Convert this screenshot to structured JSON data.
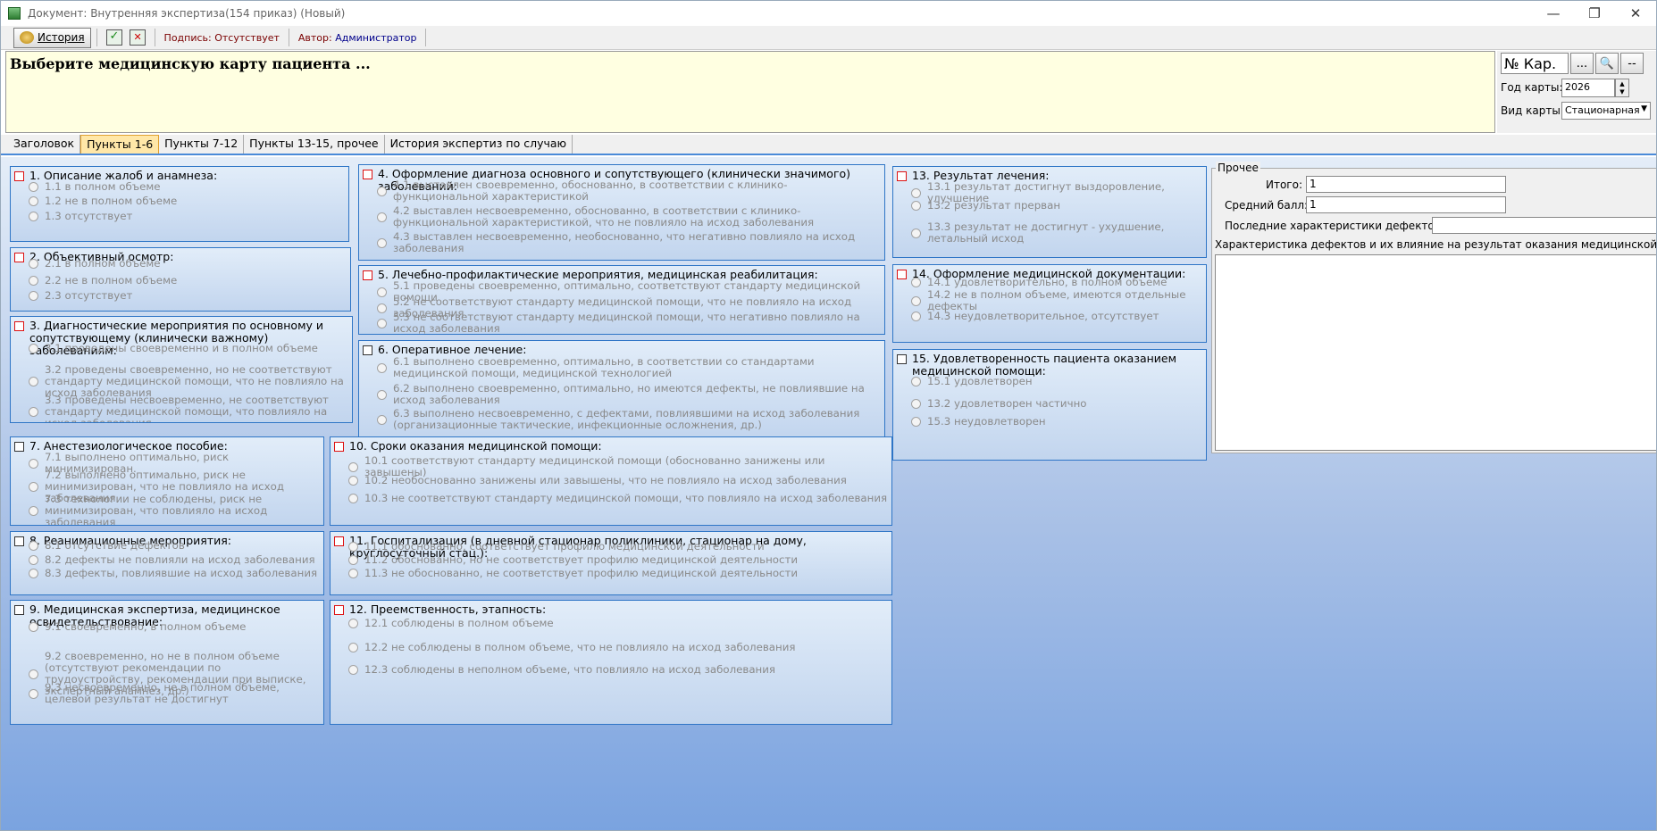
{
  "window": {
    "title": "Документ: Внутренняя экспертиза(154 приказ) (Новый)",
    "controls": [
      "—",
      "❐",
      "✕"
    ]
  },
  "toolbar": {
    "history_label": "История",
    "signature_status": "Подпись: Отсутствует",
    "author_label": "Автор:",
    "author_value": "Администратор"
  },
  "header": {
    "prompt": "Выберите медицинскую карту пациента ..."
  },
  "card_panel": {
    "card_number_placeholder": "№ Кар.",
    "browse_label": "...",
    "clear_label": "--",
    "year_label": "Год карты:",
    "year_value": "2026",
    "kind_label": "Вид карты:",
    "kind_value": "Стационарная"
  },
  "tabs": [
    "Заголовок",
    "Пункты 1-6",
    "Пункты 7-12",
    "Пункты 13-15, прочее",
    "История экспертиз по случаю"
  ],
  "active_tab": 1,
  "groups": [
    {
      "title": "1. Описание жалоб и анамнеза:",
      "checked_color": "red",
      "options": [
        "1.1 в полном объеме",
        "1.2 не в полном объеме",
        "1.3 отсутствует"
      ]
    },
    {
      "title": "2. Объективный осмотр:",
      "checked_color": "red",
      "options": [
        "2.1 в полном объеме",
        "2.2 не в полном объеме",
        "2.3 отсутствует"
      ]
    },
    {
      "title": "3. Диагностические мероприятия по основному и сопутствующему (клинически важному) заболеваниям:",
      "checked_color": "red",
      "options": [
        "3.1 проведены своевременно и в полном объеме",
        "3.2 проведены своевременно, но не соответствуют стандарту медицинской помощи, что не повлияло на исход заболевания",
        "3.3 проведены несвоевременно, не соответствуют стандарту медицинской помощи, что повлияло на исход заболевания"
      ]
    },
    {
      "title": "4. Оформление диагноза основного и сопутствующего (клинически значимого) заболеваний:",
      "checked_color": "red",
      "options": [
        "4.1 выставлен своевременно, обоснованно, в соответствии с клинико-функциональной характеристикой",
        "4.2 выставлен несвоевременно, обоснованно, в соответствии с клинико-функциональной характеристикой, что не повлияло на исход заболевания",
        "4.3 выставлен несвоевременно, необоснованно, что негативно повлияло на исход заболевания"
      ]
    },
    {
      "title": "5. Лечебно-профилактические мероприятия, медицинская реабилитация:",
      "checked_color": "red",
      "options": [
        "5.1 проведены своевременно, оптимально, соответствуют стандарту медицинской помощи",
        "5.2 не соответствуют стандарту медицинской помощи, что не повлияло на исход заболевания",
        "5.3 не соответствуют стандарту медицинской помощи, что негативно повлияло на исход заболевания"
      ]
    },
    {
      "title": "6. Оперативное лечение:",
      "checked_color": "black",
      "options": [
        "6.1 выполнено своевременно, оптимально, в соответствии со стандартами медицинской помощи, медицинской технологией",
        "6.2 выполнено своевременно, оптимально, но имеются дефекты, не повлиявшие на исход заболевания",
        "6.3 выполнено несвоевременно, с дефектами, повлиявшими на исход заболевания (организационные тактические, инфекционные осложнения, др.)"
      ]
    },
    {
      "title": "7. Анестезиологическое пособие:",
      "checked_color": "black",
      "options": [
        "7.1 выполнено оптимально, риск минимизирован.",
        "7.2 выполнено оптимально, риск не минимизирован, что не повлияло на исход  заболевания",
        "7.3 технологии не соблюдены, риск не минимизирован, что повлияло на исход заболевания"
      ]
    },
    {
      "title": "8. Реанимационные мероприятия:",
      "checked_color": "black",
      "options": [
        "8.1 отсутствие дефектов",
        "8.2 дефекты не повлияли на исход заболевания",
        "8.3 дефекты, повлиявшие на исход заболевания"
      ]
    },
    {
      "title": "9. Медицинская экспертиза, медицинское освидетельствование:",
      "checked_color": "black",
      "options": [
        "9.1 своевременно, в полном объеме",
        "9.2 своевременно, но не в полном объеме (отсутствуют рекомендации по трудоустройству, рекомендации при выписке, экспертный анамнез, др.)",
        "9.3 несвоевременно, не в полном объеме, целевой результат не достигнут"
      ]
    },
    {
      "title": "10. Сроки оказания медицинской помощи:",
      "checked_color": "red",
      "options": [
        "10.1 соответствуют стандарту медицинской помощи (обоснованно занижены  или завышены)",
        "10.2 необоснованно занижены или завышены, что не повлияло на исход заболевания",
        "10.3 не соответствуют стандарту медицинской помощи, что повлияло на исход заболевания"
      ]
    },
    {
      "title": "11. Госпитализация (в дневной стационар поликлиники, стационар на дому, круглосуточный стац.):",
      "checked_color": "red",
      "options": [
        "11.1 обоснованно, соответствует профилю медицинской деятельности",
        "11.2 обоснованно, но не соответствует профилю медицинской деятельности",
        "11.3 не обоснованно, не соответствует профилю медицинской деятельности"
      ]
    },
    {
      "title": "12. Преемственность, этапность:",
      "checked_color": "red",
      "options": [
        "12.1 соблюдены в полном объеме",
        "12.2 не соблюдены в полном объеме, что не повлияло на исход заболевания",
        "12.3 соблюдены в неполном объеме, что повлияло на исход заболевания"
      ]
    },
    {
      "title": "13. Результат лечения:",
      "checked_color": "red",
      "options": [
        "13.1 результат достигнут выздоровление, улучшение",
        "13.2 результат прерван",
        "13.3 результат не достигнут - ухудшение, летальный исход"
      ]
    },
    {
      "title": "14. Оформление медицинской документации:",
      "checked_color": "red",
      "options": [
        "14.1 удовлетворительно, в полном объеме",
        "14.2 не в полном объеме, имеются отдельные дефекты",
        "14.3 неудовлетворительное, отсутствует"
      ]
    },
    {
      "title": "15. Удовлетворенность пациента оказанием медицинской помощи:",
      "checked_color": "black",
      "options": [
        "15.1 удовлетворен",
        "13.2 удовлетворен частично",
        "15.3 неудовлетворен"
      ]
    }
  ],
  "other": {
    "legend": "Прочее",
    "total_label": "Итого:",
    "total_value": "1",
    "avg_label": "Средний балл:",
    "avg_value": "1",
    "last_defects_label": "Последние характеристики дефектов:",
    "last_defects_value": "",
    "defects_memo_label": "Характеристика дефектов и их влияние на результат оказания медицинской помощи:",
    "defects_memo_value": ""
  }
}
